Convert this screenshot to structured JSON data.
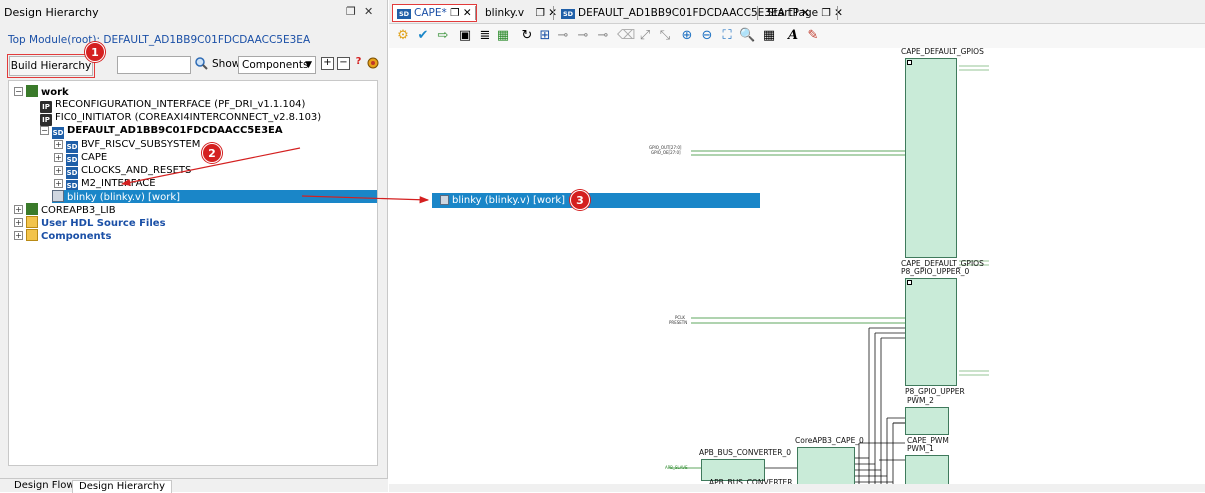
{
  "left_panel": {
    "title": "Design Hierarchy",
    "float_icon": "❐",
    "close_icon": "✕",
    "top_module": "Top Module(root): DEFAULT_AD1BB9C01FDCDAACC5E3EA",
    "build_button": "Build Hierarchy",
    "filter_value": "",
    "show_label": "Show:",
    "show_value": "Components",
    "tree": [
      {
        "label": "work",
        "icon": "library-icon",
        "bold": true
      },
      {
        "label": "RECONFIGURATION_INTERFACE (PF_DRI_v1.1.104)",
        "icon": "ip-icon"
      },
      {
        "label": "FIC0_INITIATOR (COREAXI4INTERCONNECT_v2.8.103)",
        "icon": "ip-icon"
      },
      {
        "label": "DEFAULT_AD1BB9C01FDCDAACC5E3EA",
        "icon": "smartdesign-icon",
        "bold": true
      },
      {
        "label": "BVF_RISCV_SUBSYSTEM",
        "icon": "smartdesign-icon"
      },
      {
        "label": "CAPE",
        "icon": "smartdesign-icon"
      },
      {
        "label": "CLOCKS_AND_RESETS",
        "icon": "smartdesign-icon"
      },
      {
        "label": "M2_INTERFACE",
        "icon": "smartdesign-icon"
      },
      {
        "label": "blinky (blinky.v) [work]",
        "icon": "hdl-file-icon",
        "selected": true
      },
      {
        "label": "COREAPB3_LIB",
        "icon": "library-icon"
      },
      {
        "label": "User HDL Source Files",
        "icon": "folder-icon",
        "blue": true
      },
      {
        "label": "Components",
        "icon": "folder-icon",
        "blue": true
      }
    ],
    "bottom_tabs": [
      "Design Flow",
      "Design Hierarchy"
    ]
  },
  "annotations": {
    "badge1": "1",
    "badge2": "2",
    "badge3": "3",
    "color": "#d42020"
  },
  "doc_tabs": [
    {
      "label": "CAPE*",
      "suffix": "❐ ✕",
      "active": true
    },
    {
      "label": "blinky.v",
      "suffix": "❐ ✕"
    },
    {
      "label": "DEFAULT_AD1BB9C01FDCDAACC5E3EA",
      "suffix": "❐ ✕"
    },
    {
      "label": "StartPage",
      "suffix": "❐ ✕"
    }
  ],
  "canvas": {
    "drag_item": "blinky (blinky.v) [work]",
    "blocks": {
      "gpios_title": "CAPE_DEFAULT_GPIOS",
      "gpios_footer": "CAPE_DEFAULT_GPIOS",
      "p8_title": "P8_GPIO_UPPER_0",
      "p8_footer": "P8_GPIO_UPPER",
      "pwm2_title": "PWM_2",
      "pwm2_footer": "CAPE_PWM",
      "pwm1_title": "PWM_1",
      "apb_bus_title": "APB_BUS_CONVERTER_0",
      "apb_bus_footer": "APB_BUS_CONVERTER",
      "coreapb_title": "CoreAPB3_CAPE_0"
    },
    "gpios_inputs": [
      "GPIO_OUT[27:0]",
      "GPIO_OE[27:0]"
    ],
    "p8_inputs": [
      "PCLK",
      "PRESETN"
    ],
    "apb_input": "APB_SLAVE"
  },
  "accent_colors": {
    "selection": "#1a86c8",
    "block_fill": "#c9ebd8",
    "tab_outline": "#e23b3b"
  }
}
